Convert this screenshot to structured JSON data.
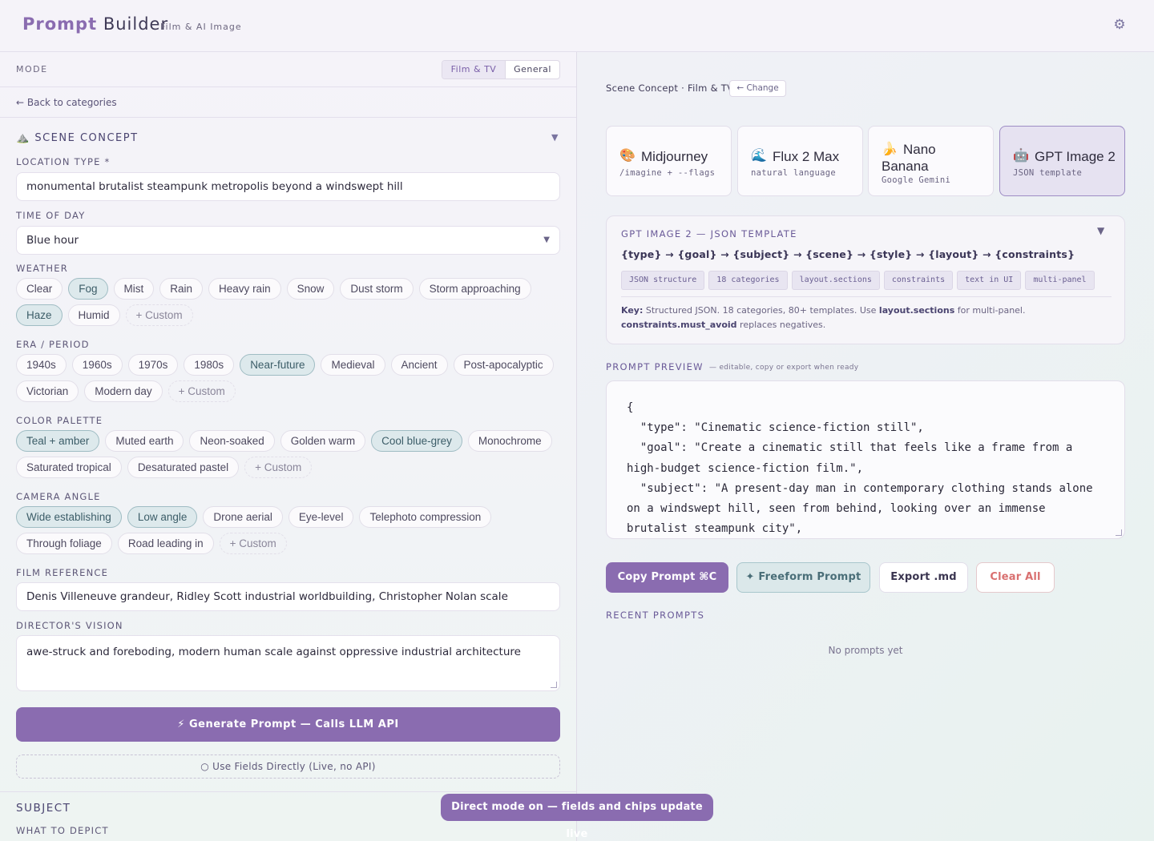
{
  "app": {
    "title_part1": "Prompt",
    "title_part2": "Builder",
    "subtitle": "Film & AI Image",
    "settings_icon": "⚙"
  },
  "left": {
    "mode": {
      "label": "MODE",
      "options": [
        "Film & TV",
        "General"
      ],
      "selected": "Film & TV"
    },
    "back_link": "← Back to categories",
    "section": {
      "icon": "⛰️",
      "title": "SCENE CONCEPT",
      "caret": "▼"
    },
    "fields": {
      "location_type": {
        "label": "LOCATION TYPE *",
        "value": "monumental brutalist steampunk metropolis beyond a windswept hill"
      },
      "time_of_day": {
        "label": "TIME OF DAY",
        "value": "Blue hour",
        "caret": "▼"
      },
      "weather": {
        "label": "WEATHER",
        "chips": [
          {
            "label": "Clear",
            "selected": false
          },
          {
            "label": "Fog",
            "selected": true
          },
          {
            "label": "Mist",
            "selected": false
          },
          {
            "label": "Rain",
            "selected": false
          },
          {
            "label": "Heavy rain",
            "selected": false
          },
          {
            "label": "Snow",
            "selected": false
          },
          {
            "label": "Dust storm",
            "selected": false
          },
          {
            "label": "Storm approaching",
            "selected": false
          },
          {
            "label": "Haze",
            "selected": true
          },
          {
            "label": "Humid",
            "selected": false
          },
          {
            "label": "+ Custom",
            "selected": false,
            "custom": true
          }
        ]
      },
      "era": {
        "label": "ERA / PERIOD",
        "chips": [
          {
            "label": "1940s",
            "selected": false
          },
          {
            "label": "1960s",
            "selected": false
          },
          {
            "label": "1970s",
            "selected": false
          },
          {
            "label": "1980s",
            "selected": false
          },
          {
            "label": "Near-future",
            "selected": true
          },
          {
            "label": "Medieval",
            "selected": false
          },
          {
            "label": "Ancient",
            "selected": false
          },
          {
            "label": "Post-apocalyptic",
            "selected": false
          },
          {
            "label": "Victorian",
            "selected": false
          },
          {
            "label": "Modern day",
            "selected": false
          },
          {
            "label": "+ Custom",
            "selected": false,
            "custom": true
          }
        ]
      },
      "palette": {
        "label": "COLOR PALETTE",
        "chips": [
          {
            "label": "Teal + amber",
            "selected": true
          },
          {
            "label": "Muted earth",
            "selected": false
          },
          {
            "label": "Neon-soaked",
            "selected": false
          },
          {
            "label": "Golden warm",
            "selected": false
          },
          {
            "label": "Cool blue-grey",
            "selected": true
          },
          {
            "label": "Monochrome",
            "selected": false
          },
          {
            "label": "Saturated tropical",
            "selected": false
          },
          {
            "label": "Desaturated pastel",
            "selected": false
          },
          {
            "label": "+ Custom",
            "selected": false,
            "custom": true
          }
        ]
      },
      "camera": {
        "label": "CAMERA ANGLE",
        "chips": [
          {
            "label": "Wide establishing",
            "selected": true
          },
          {
            "label": "Low angle",
            "selected": true
          },
          {
            "label": "Drone aerial",
            "selected": false
          },
          {
            "label": "Eye-level",
            "selected": false
          },
          {
            "label": "Telephoto compression",
            "selected": false
          },
          {
            "label": "Through foliage",
            "selected": false
          },
          {
            "label": "Road leading in",
            "selected": false
          },
          {
            "label": "+ Custom",
            "selected": false,
            "custom": true
          }
        ]
      },
      "film_reference": {
        "label": "FILM REFERENCE",
        "value": "Denis Villeneuve grandeur, Ridley Scott industrial worldbuilding, Christopher Nolan scale"
      },
      "directors_vision": {
        "label": "DIRECTOR'S VISION",
        "value": "awe-struck and foreboding, modern human scale against oppressive industrial architecture"
      }
    },
    "generate_button": "⚡  Generate Prompt — Calls LLM API",
    "direct_button": "○ Use Fields Directly (Live, no API)",
    "subject": {
      "title": "SUBJECT",
      "what_to_depict_label": "WHAT TO DEPICT"
    }
  },
  "right": {
    "breadcrumb": "Scene Concept · Film & TV",
    "change_button": "← Change",
    "models": [
      {
        "emoji": "🎨",
        "name": "Midjourney",
        "sub": "/imagine + --flags",
        "selected": false
      },
      {
        "emoji": "🌊",
        "name": "Flux 2 Max",
        "sub": "natural language",
        "selected": false
      },
      {
        "emoji": "🍌",
        "name": "Nano Banana",
        "sub": "Google Gemini",
        "selected": false
      },
      {
        "emoji": "🤖",
        "name": "GPT Image 2",
        "sub": "JSON template",
        "selected": true
      }
    ],
    "template": {
      "title": "GPT IMAGE 2 — JSON TEMPLATE",
      "caret": "▼",
      "chain": "{type} → {goal} → {subject} → {scene} → {style} → {layout} → {constraints}",
      "tags": [
        "JSON structure",
        "18 categories",
        "layout.sections",
        "constraints",
        "text in UI",
        "multi-panel"
      ],
      "key_label": "Key:",
      "key_text_1": " Structured JSON. 18 categories, 80+ templates. Use ",
      "key_bold_1": "layout.sections",
      "key_text_2": " for multi-panel.",
      "key_bold_2": "constraints.must_avoid",
      "key_text_3": " replaces negatives."
    },
    "preview": {
      "label": "PROMPT PREVIEW",
      "hint": "— editable, copy or export when ready",
      "text": "{\n  \"type\": \"Cinematic science-fiction still\",\n  \"goal\": \"Create a cinematic still that feels like a frame from a high-budget science-fiction film.\",\n  \"subject\": \"A present-day man in contemporary clothing stands alone on a windswept hill, seen from behind, looking over an immense brutalist steampunk city\","
    },
    "actions": {
      "copy": "Copy Prompt ⌘C",
      "freeform": "✦ Freeform Prompt",
      "export": "Export .md",
      "clear": "Clear All"
    },
    "recent": {
      "label": "RECENT PROMPTS",
      "empty": "No prompts yet"
    }
  },
  "toast": "Direct mode on — fields and chips update live",
  "colors": {
    "accent": "#8a6cb0",
    "chip_selected_bg": "#dde9ec",
    "chip_selected_border": "#9fbcc3",
    "danger": "#d97070"
  }
}
